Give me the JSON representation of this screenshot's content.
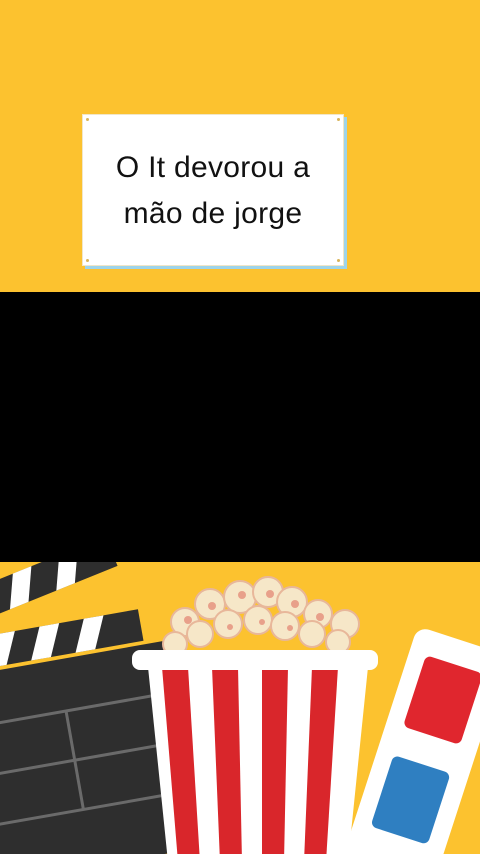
{
  "caption": {
    "line1": "O It devorou a",
    "line2": "mão de jorge"
  },
  "colors": {
    "background": "#FCC22F",
    "video": "#000000",
    "popcorn_red": "#D9262B",
    "clapper": "#2E2E2E",
    "glasses_red": "#E0262E",
    "glasses_blue": "#2F7FC1"
  },
  "icons": [
    "clapperboard-icon",
    "popcorn-icon",
    "3d-glasses-icon"
  ]
}
